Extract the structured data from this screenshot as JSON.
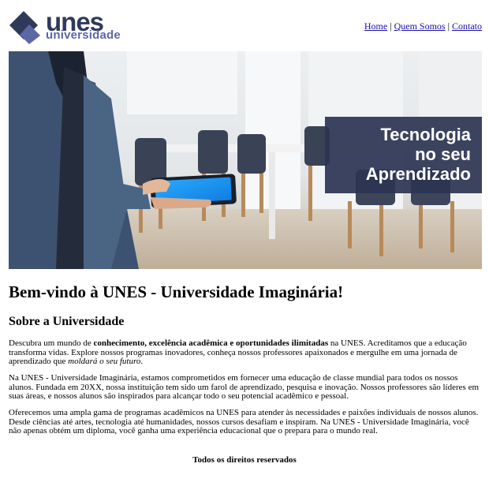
{
  "logo": {
    "word1": "unes",
    "word2": "universidade"
  },
  "nav": {
    "links": [
      "Home",
      "Quem Somos",
      "Contato"
    ],
    "separator": "|"
  },
  "banner": {
    "headline": [
      "Tecnologia",
      "no seu",
      "Aprendizado"
    ]
  },
  "main": {
    "title": "Bem-vindo à UNES - Universidade Imaginária!",
    "section_title": "Sobre a Universidade",
    "p1": {
      "before": "Descubra um mundo de ",
      "bold": "conhecimento, excelência acadêmica e oportunidades ilimitadas",
      "middle": " na UNES. Acreditamos que a educação transforma vidas. Explore nossos programas inovadores, conheça nossos professores apaixonados e mergulhe em uma jornada de aprendizado que ",
      "italic": "moldará o seu futuro",
      "after": "."
    },
    "p2": "Na UNES - Universidade Imaginária, estamos comprometidos em fornecer uma educação de classe mundial para todos os nossos alunos. Fundada em 20XX, nossa instituição tem sido um farol de aprendizado, pesquisa e inovação. Nossos professores são líderes em suas áreas, e nossos alunos são inspirados para alcançar todo o seu potencial acadêmico e pessoal.",
    "p3": "Oferecemos uma ampla gama de programas acadêmicos na UNES para atender às necessidades e paixões individuais de nossos alunos. Desde ciências até artes, tecnologia até humanidades, nossos cursos desafiam e inspiram. Na UNES - Universidade Imaginária, você não apenas obtém um diploma, você ganha uma experiência educacional que o prepara para o mundo real."
  },
  "footer": {
    "text": "Todos os direitos reservados"
  },
  "colors": {
    "brand_dark": "#2f3a5a",
    "brand_light": "#5d66a6",
    "link": "#1a0dab",
    "panel": "#2c3452"
  }
}
